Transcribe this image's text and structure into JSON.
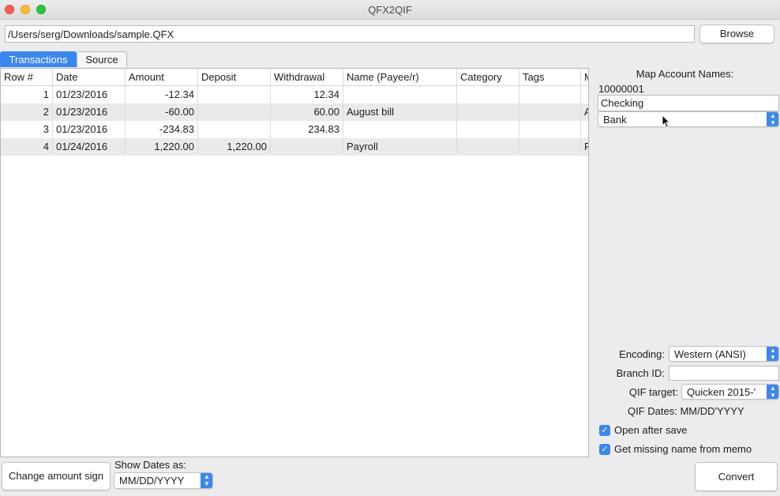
{
  "window": {
    "title": "QFX2QIF",
    "close_color": "#fe5f57",
    "minimize_color": "#febc2e",
    "zoom_color": "#28c840"
  },
  "toolbar": {
    "file_path": "/Users/serg/Downloads/sample.QFX",
    "browse_label": "Browse"
  },
  "tabs": [
    {
      "label": "Transactions",
      "active": true
    },
    {
      "label": "Source",
      "active": false
    }
  ],
  "table": {
    "headers": [
      "Row #",
      "Date",
      "Amount",
      "Deposit",
      "Withdrawal",
      "Name (Payee/r)",
      "Category",
      "Tags",
      "M"
    ],
    "rows": [
      {
        "row": "1",
        "date": "01/23/2016",
        "amount": "-12.34",
        "deposit": "",
        "withdrawal": "12.34",
        "name": "",
        "category": "",
        "tags": "",
        "memo": ""
      },
      {
        "row": "2",
        "date": "01/23/2016",
        "amount": "-60.00",
        "deposit": "",
        "withdrawal": "60.00",
        "name": "August bill",
        "category": "",
        "tags": "",
        "memo": "A"
      },
      {
        "row": "3",
        "date": "01/23/2016",
        "amount": "-234.83",
        "deposit": "",
        "withdrawal": "234.83",
        "name": "",
        "category": "",
        "tags": "",
        "memo": ""
      },
      {
        "row": "4",
        "date": "01/24/2016",
        "amount": "1,220.00",
        "deposit": "1,220.00",
        "withdrawal": "",
        "name": "Payroll",
        "category": "",
        "tags": "",
        "memo": "P"
      }
    ]
  },
  "panel": {
    "map_title": "Map Account Names:",
    "account_id": "10000001",
    "account_name": "Checking",
    "account_type": "Bank",
    "encoding_label": "Encoding:",
    "encoding_value": "Western (ANSI)",
    "branch_label": "Branch ID:",
    "branch_value": "",
    "qif_target_label": "QIF target:",
    "qif_target_value": "Quicken 2015-'",
    "qif_dates": "QIF Dates: MM/DD'YYYY",
    "open_after_save": "Open after save",
    "get_missing_name": "Get missing name from memo"
  },
  "bottom": {
    "change_sign_label": "Change amount sign",
    "show_dates_label": "Show Dates as:",
    "date_format": "MM/DD/YYYY",
    "convert_label": "Convert"
  }
}
